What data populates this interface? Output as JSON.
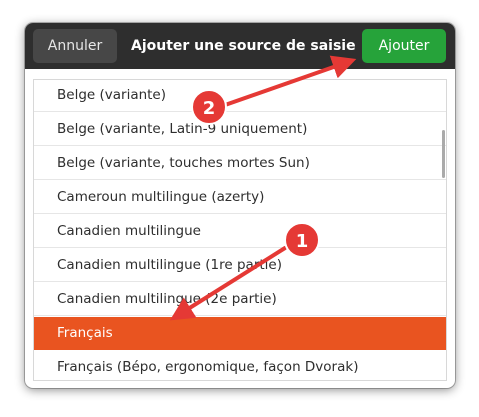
{
  "header": {
    "cancel_label": "Annuler",
    "title": "Ajouter une source de saisie",
    "add_label": "Ajouter"
  },
  "list": {
    "items": [
      "Belge (variante)",
      "Belge (variante, Latin-9 uniquement)",
      "Belge (variante, touches mortes Sun)",
      "Cameroun multilingue (azerty)",
      "Canadien multilingue",
      "Canadien multilingue (1re partie)",
      "Canadien multilingue (2e partie)",
      "Français",
      "Français (Bépo, ergonomique, façon Dvorak)"
    ],
    "selected_index": 7
  },
  "annotations": {
    "badge_1": "1",
    "badge_2": "2"
  },
  "colors": {
    "accent": "#e95420",
    "confirm": "#26a33a",
    "annotation": "#e53935"
  }
}
